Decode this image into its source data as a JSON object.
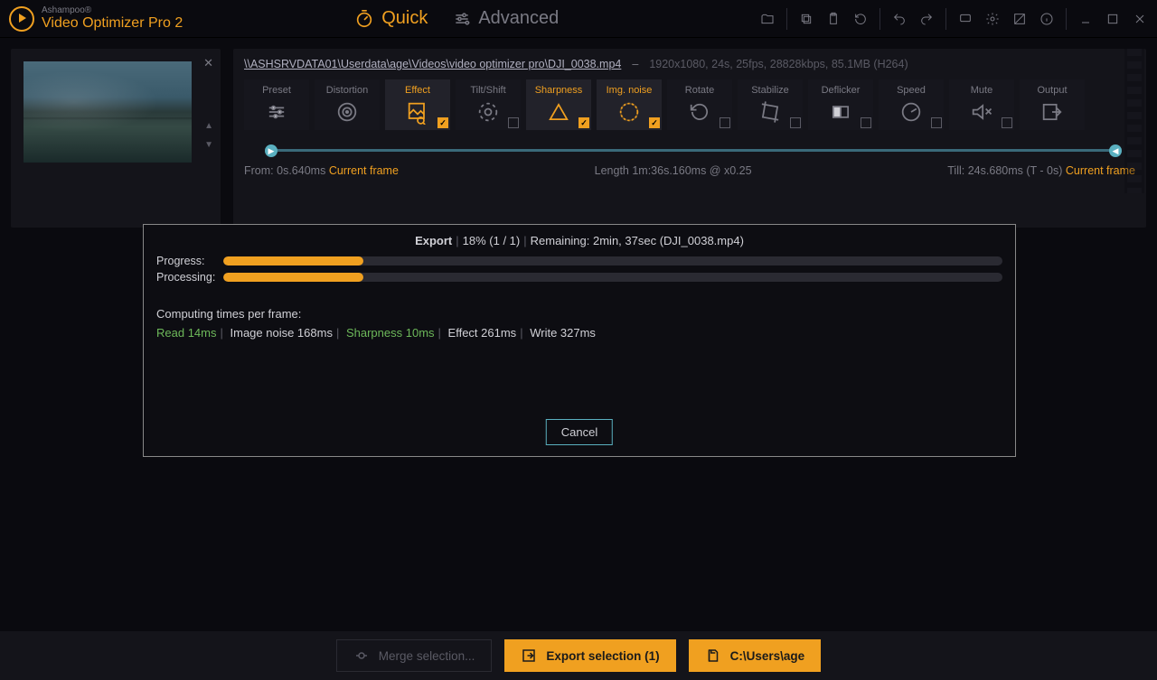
{
  "brand": {
    "line1": "Ashampoo®",
    "line2": "Video Optimizer Pro 2"
  },
  "modes": {
    "quick": "Quick",
    "advanced": "Advanced"
  },
  "file": {
    "path": "\\\\ASHSRVDATA01\\Userdata\\age\\Videos\\video optimizer pro\\DJI_0038.mp4",
    "meta": "1920x1080, 24s, 25fps, 28828kbps, 85.1MB (H264)"
  },
  "tiles": [
    {
      "label": "Preset",
      "icon": "sliders",
      "active": false,
      "checked": null
    },
    {
      "label": "Distortion",
      "icon": "target",
      "active": false,
      "checked": null
    },
    {
      "label": "Effect",
      "icon": "image-fx",
      "active": true,
      "checked": true
    },
    {
      "label": "Tilt/Shift",
      "icon": "aperture",
      "active": false,
      "checked": false
    },
    {
      "label": "Sharpness",
      "icon": "triangle",
      "active": true,
      "checked": true
    },
    {
      "label": "Img. noise",
      "icon": "globe",
      "active": true,
      "checked": true
    },
    {
      "label": "Rotate",
      "icon": "rotate",
      "active": false,
      "checked": false
    },
    {
      "label": "Stabilize",
      "icon": "crop",
      "active": false,
      "checked": false
    },
    {
      "label": "Deflicker",
      "icon": "contrast",
      "active": false,
      "checked": false
    },
    {
      "label": "Speed",
      "icon": "gauge",
      "active": false,
      "checked": false
    },
    {
      "label": "Mute",
      "icon": "mute",
      "active": false,
      "checked": false
    },
    {
      "label": "Output",
      "icon": "output",
      "active": false,
      "checked": null
    }
  ],
  "timeline": {
    "from_label": "From:",
    "from_time": "0s.640ms",
    "from_cur": "Current frame",
    "length_label": "Length 1m:36s.160ms @ x0.25",
    "till_label": "Till:",
    "till_time": "24s.680ms (T - 0s)",
    "till_cur": "Current frame"
  },
  "export": {
    "title": "Export",
    "percent_text": "18% (1 / 1)",
    "remaining": "Remaining: 2min, 37sec (DJI_0038.mp4)",
    "progress_label": "Progress:",
    "processing_label": "Processing:",
    "progress_pct": 18,
    "processing_pct": 18,
    "computing_label": "Computing times per frame:",
    "times": {
      "read": "Read 14ms",
      "noise": "Image noise 168ms",
      "sharp": "Sharpness 10ms",
      "effect": "Effect 261ms",
      "write": "Write 327ms"
    },
    "cancel": "Cancel"
  },
  "bottom": {
    "merge": "Merge selection...",
    "export": "Export selection (1)",
    "path": "C:\\Users\\age"
  }
}
